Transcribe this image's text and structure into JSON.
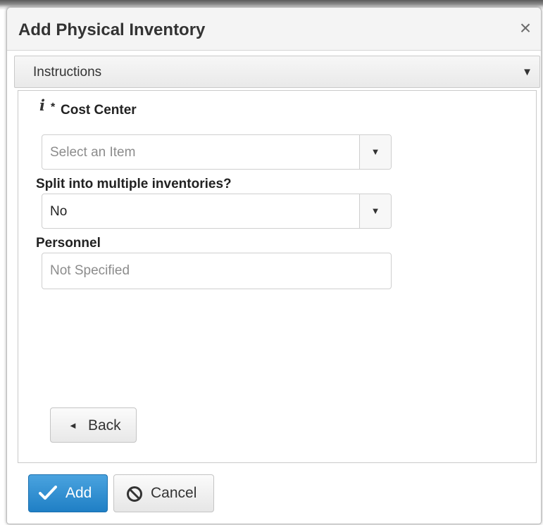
{
  "dialog": {
    "title": "Add Physical Inventory",
    "close_symbol": "×"
  },
  "instructions": {
    "label": "Instructions",
    "caret": "▼"
  },
  "form": {
    "cost_center": {
      "required_marker": "*",
      "label": "Cost Center",
      "placeholder": "Select an Item",
      "info_icon": "i"
    },
    "split": {
      "label": "Split into multiple inventories?",
      "value": "No"
    },
    "personnel": {
      "label": "Personnel",
      "placeholder": "Not Specified"
    },
    "dropdown_arrow": "▼",
    "back_button": {
      "label": "Back",
      "caret": "◄"
    }
  },
  "footer": {
    "add_label": "Add",
    "cancel_label": "Cancel"
  },
  "colors": {
    "primary": "#1f7fc5",
    "text": "#333333",
    "border": "#cfcfcf",
    "placeholder": "#8c8c8c"
  },
  "icons": {
    "close": "close-icon",
    "dropdown": "chevron-down-icon",
    "info": "info-icon",
    "back": "chevron-left-icon",
    "add": "checkmark-icon",
    "cancel": "ban-icon"
  }
}
